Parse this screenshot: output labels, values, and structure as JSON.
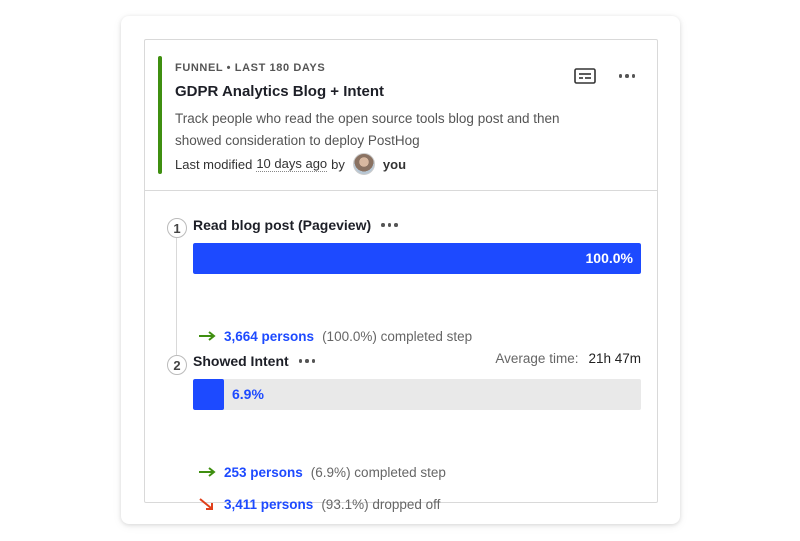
{
  "header": {
    "meta": "FUNNEL • LAST 180 DAYS",
    "title": "GDPR Analytics Blog + Intent",
    "description": "Track people who read the open source tools blog post and then showed consideration to deploy PostHog",
    "modified_prefix": "Last modified",
    "modified_time": "10 days ago",
    "modified_by": "by",
    "user": "you"
  },
  "colors": {
    "accent": "#3f8f10",
    "bar": "#1d4aff",
    "completed_arrow": "#3f8f10",
    "dropped_arrow": "#e0401b"
  },
  "steps": [
    {
      "number": "1",
      "name": "Read blog post (Pageview)",
      "percent": 100.0,
      "percent_label": "100.0%",
      "completed_count": "3,664 persons",
      "completed_detail": "(100.0%) completed step"
    },
    {
      "number": "2",
      "name": "Showed Intent",
      "avg_time_label": "Average time:",
      "avg_time_value": "21h 47m",
      "percent": 6.9,
      "percent_label": "6.9%",
      "completed_count": "253 persons",
      "completed_detail": "(6.9%) completed step",
      "dropped_count": "3,411 persons",
      "dropped_detail": "(93.1%) dropped off"
    }
  ]
}
